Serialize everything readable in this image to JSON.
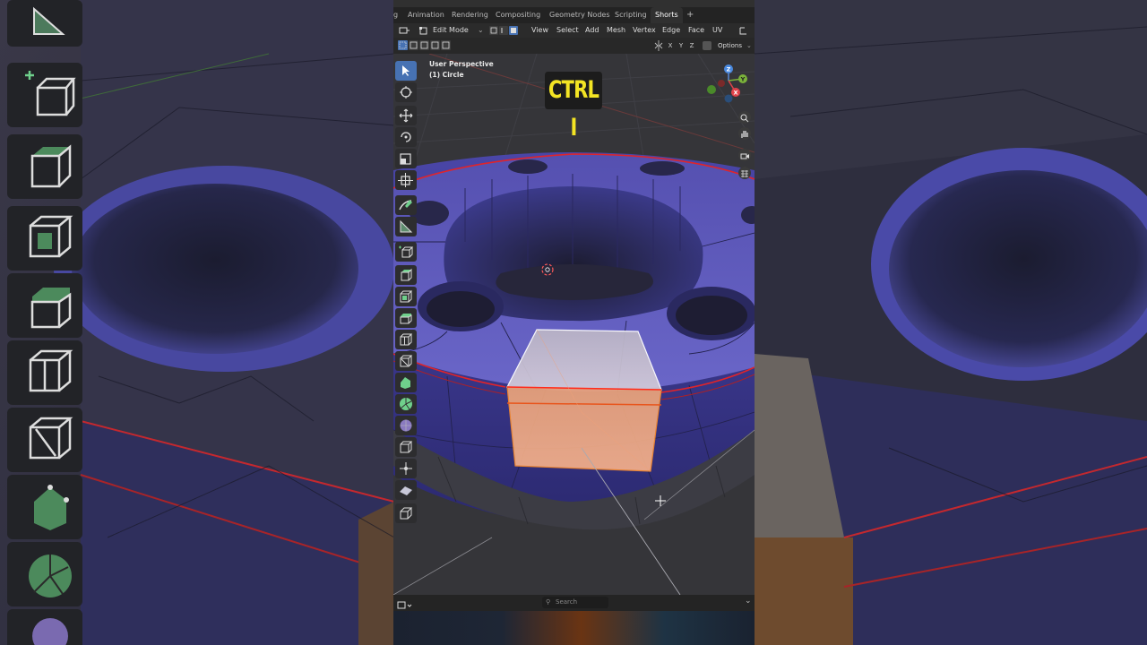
{
  "topbar": {
    "tabs": [
      {
        "label": "g"
      },
      {
        "label": "Animation"
      },
      {
        "label": "Rendering"
      },
      {
        "label": "Compositing"
      },
      {
        "label": "Geometry Nodes"
      },
      {
        "label": "Scripting"
      },
      {
        "label": "Shorts",
        "active": true
      }
    ],
    "add_tab": "+"
  },
  "header": {
    "mode": "Edit Mode",
    "menus": [
      "View",
      "Select",
      "Add",
      "Mesh",
      "Vertex",
      "Edge",
      "Face",
      "UV"
    ],
    "axes": [
      "X",
      "Y",
      "Z"
    ],
    "options": "Options"
  },
  "viewport": {
    "perspective": "User Perspective",
    "object": "(1) Circle",
    "hotkey": "CTRL I"
  },
  "gizmo": {
    "x": "X",
    "y": "Y",
    "z": "Z"
  },
  "statusbar": {
    "search_placeholder": "Search"
  },
  "colors": {
    "mesh": "#5d58b8",
    "selection": "#f5892d",
    "hotkey_text": "#f3e424",
    "active_tool": "#4772b3",
    "seam": "#e0242a"
  },
  "toolbar": {
    "tools": [
      "select-box-icon",
      "cursor-icon",
      "move-icon",
      "rotate-icon",
      "scale-icon",
      "transform-icon",
      "annotate-icon",
      "measure-icon",
      "add-cube-icon",
      "extrude-icon",
      "inset-icon",
      "bevel-icon",
      "loop-cut-icon",
      "knife-icon",
      "poly-build-icon",
      "spin-icon",
      "smooth-icon",
      "edge-slide-icon",
      "shrink-fatten-icon",
      "shear-icon",
      "rip-icon"
    ]
  }
}
